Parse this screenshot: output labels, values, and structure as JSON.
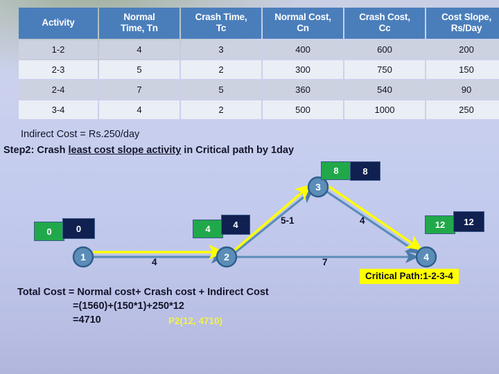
{
  "table": {
    "headers": [
      "Activity",
      "Normal Time, Tn",
      "Crash Time, Tc",
      "Normal Cost, Cn",
      "Crash Cost, Cc",
      "Cost Slope, Rs/Day"
    ],
    "header_lines": [
      [
        "Activity",
        ""
      ],
      [
        "Normal",
        "Time, Tn"
      ],
      [
        "Crash Time,",
        "Tc"
      ],
      [
        "Normal Cost,",
        "Cn"
      ],
      [
        "Crash Cost,",
        "Cc"
      ],
      [
        "Cost Slope,",
        "Rs/Day"
      ]
    ],
    "rows": [
      [
        "1-2",
        "4",
        "3",
        "400",
        "600",
        "200"
      ],
      [
        "2-3",
        "5",
        "2",
        "300",
        "750",
        "150"
      ],
      [
        "2-4",
        "7",
        "5",
        "360",
        "540",
        "90"
      ],
      [
        "3-4",
        "4",
        "2",
        "500",
        "1000",
        "250"
      ]
    ]
  },
  "notes": {
    "indirect_cost": "Indirect Cost = Rs.250/day",
    "step2_prefix": "Step2: Crash ",
    "step2_underlined": "least cost slope activity",
    "step2_suffix": " in Critical path by 1day"
  },
  "diagram": {
    "nodes": [
      {
        "id": "1",
        "early": "0",
        "late": "0"
      },
      {
        "id": "2",
        "early": "4",
        "late": "4"
      },
      {
        "id": "3",
        "early": "8",
        "late": "8"
      },
      {
        "id": "4",
        "early": "12",
        "late": "12"
      }
    ],
    "edges": [
      {
        "from": "1",
        "to": "2",
        "label": "4"
      },
      {
        "from": "2",
        "to": "3",
        "label": "5-1"
      },
      {
        "from": "2",
        "to": "4",
        "label": "7"
      },
      {
        "from": "3",
        "to": "4",
        "label": "4"
      }
    ],
    "critical_path_banner": "Critical Path:1-2-3-4",
    "colors": {
      "node_fill": "#5b8db8",
      "edge": "#5b8db8",
      "critical_highlight": "#ffff00",
      "early_box": "#21a84a",
      "late_box": "#102050",
      "banner": "#ffff00"
    }
  },
  "totals": {
    "line1": "Total Cost = Normal cost+ Crash cost + Indirect Cost",
    "line2": "=(1560)+(150*1)+250*12",
    "line3": "=4710",
    "point_label": "P2(12, 4710)"
  }
}
